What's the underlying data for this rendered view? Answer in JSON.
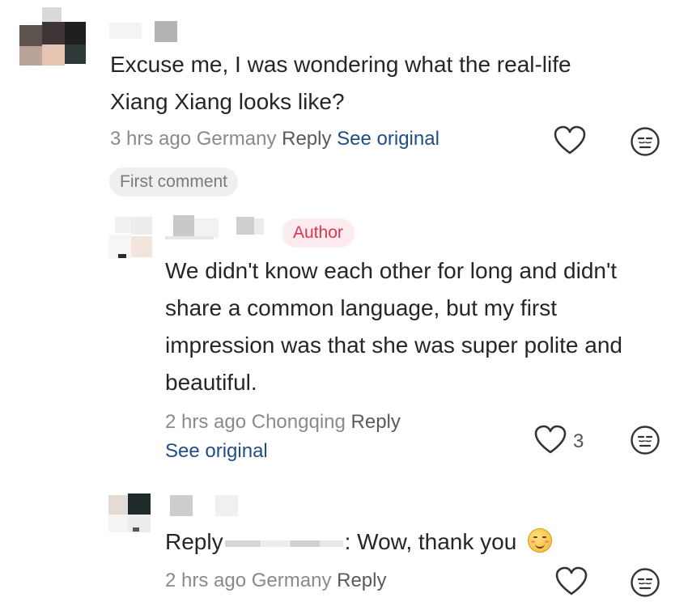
{
  "comments": [
    {
      "text": "Excuse me, I was wondering what the real-life Xiang Xiang looks like?",
      "time": "3 hrs ago",
      "location": "Germany",
      "reply_label": "Reply",
      "see_original": "See original",
      "badge": "First comment"
    },
    {
      "author_badge": "Author",
      "text": "We didn't know each other for long and didn't share a common language, but my first impression was that she was super polite and beautiful.",
      "time": "2 hrs ago",
      "location": "Chongqing",
      "reply_label": "Reply",
      "see_original": "See original",
      "like_count": "3"
    },
    {
      "reply_prefix": "Reply",
      "text": ": Wow, thank you",
      "time": "2 hrs ago",
      "location": "Germany",
      "reply_label": "Reply"
    }
  ],
  "icons": {
    "like": "heart-outline-icon",
    "react": "neutral-face-icon"
  }
}
